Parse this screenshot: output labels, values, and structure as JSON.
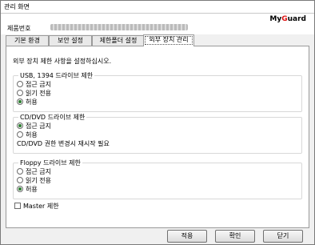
{
  "window": {
    "title": "관리 화면"
  },
  "header": {
    "logo": "MyGuard",
    "user_label": "제품번호"
  },
  "tabs": [
    {
      "label": "기본 환경"
    },
    {
      "label": "보안 설정"
    },
    {
      "label": "제한폴더 설정"
    },
    {
      "label": "외부 장치 관리",
      "selected": true
    }
  ],
  "panel": {
    "intro": "외부 장치 제한 사항을 설정하십시오.",
    "usb": {
      "title": "USB, 1394 드라이브 제한",
      "options": [
        "접근 금지",
        "읽기 전용",
        "허용"
      ],
      "selected": "허용"
    },
    "cd": {
      "title": "CD/DVD 드라이브 제한",
      "options": [
        "접근 금지",
        "허용"
      ],
      "selected": "접근 금지",
      "note": "CD/DVD 권한 변경시 재시작 필요"
    },
    "floppy": {
      "title": "Floppy 드라이브 제한",
      "options": [
        "접근 금지",
        "읽기 전용",
        "허용"
      ],
      "selected": "허용"
    },
    "master": {
      "label": "Master 제한",
      "checked": false
    }
  },
  "buttons": {
    "apply": "적용",
    "ok": "확인",
    "close": "닫기"
  },
  "colors": {
    "radio_selected": "#2e7d32",
    "logo_accent": "#dd1111"
  }
}
